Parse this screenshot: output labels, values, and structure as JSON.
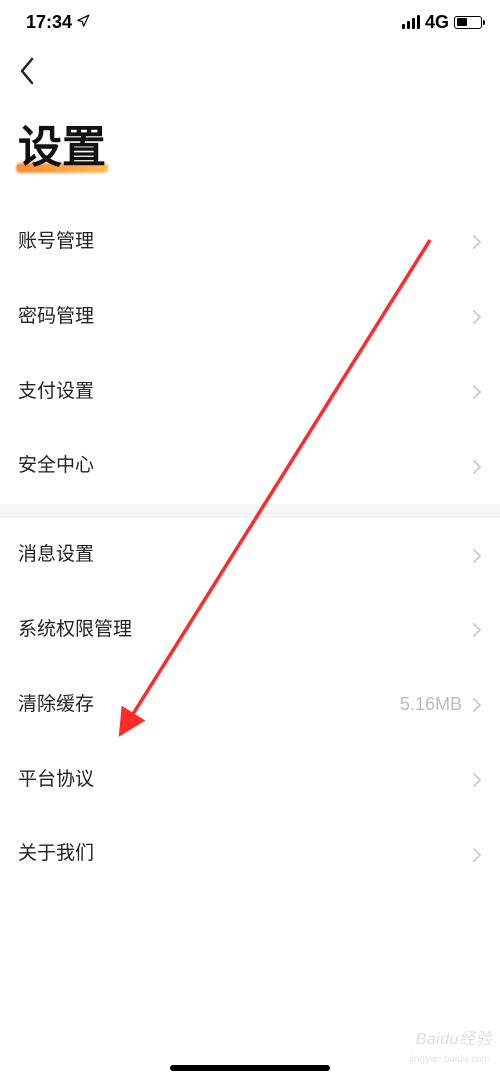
{
  "status_bar": {
    "time": "17:34",
    "network_label": "4G"
  },
  "page_title": "设置",
  "sections": [
    [
      {
        "label": "账号管理",
        "value": ""
      },
      {
        "label": "密码管理",
        "value": ""
      },
      {
        "label": "支付设置",
        "value": ""
      },
      {
        "label": "安全中心",
        "value": ""
      }
    ],
    [
      {
        "label": "消息设置",
        "value": ""
      },
      {
        "label": "系统权限管理",
        "value": ""
      },
      {
        "label": "清除缓存",
        "value": "5.16MB"
      },
      {
        "label": "平台协议",
        "value": ""
      },
      {
        "label": "关于我们",
        "value": ""
      }
    ]
  ],
  "watermark": {
    "main": "Baidu经验",
    "sub": "jingyan.baidu.com"
  },
  "annotation": {
    "target_item_label": "清除缓存"
  }
}
